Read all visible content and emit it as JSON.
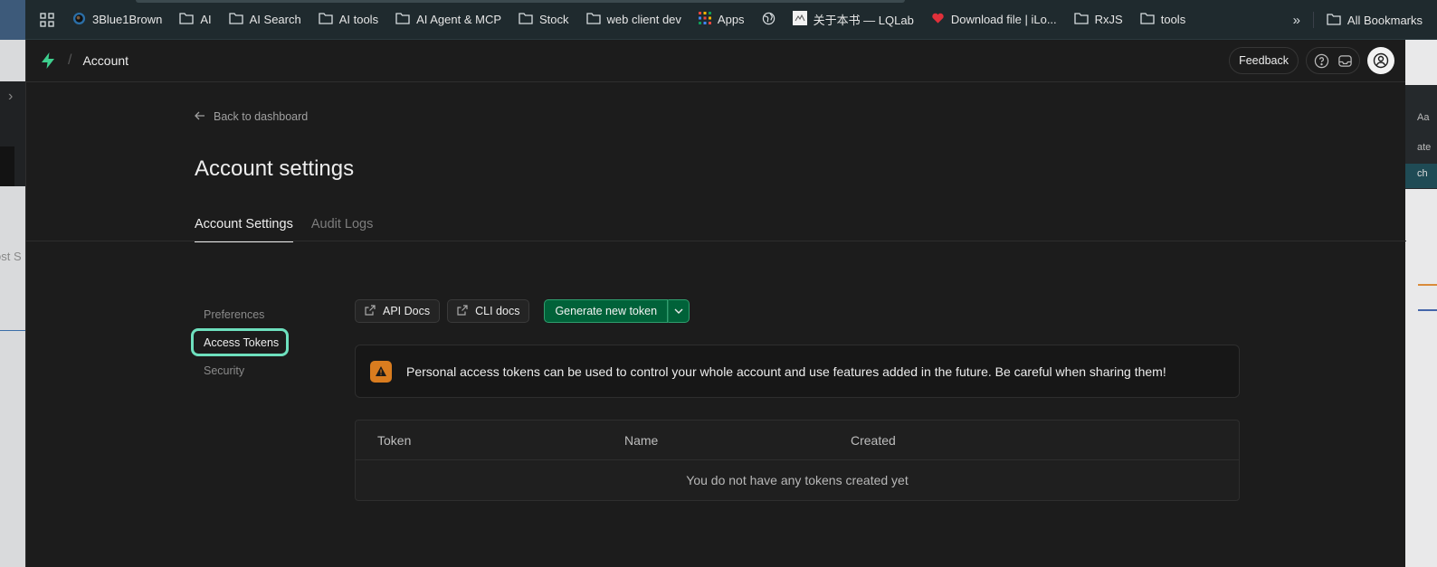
{
  "bookmarks": [
    {
      "label": "3Blue1Brown",
      "icon": "3blue1brown-icon"
    },
    {
      "label": "AI",
      "icon": "folder-icon"
    },
    {
      "label": "AI Search",
      "icon": "folder-icon"
    },
    {
      "label": "AI tools",
      "icon": "folder-icon"
    },
    {
      "label": "AI Agent & MCP",
      "icon": "folder-icon"
    },
    {
      "label": "Stock",
      "icon": "folder-icon"
    },
    {
      "label": "web client dev",
      "icon": "folder-icon"
    },
    {
      "label": "Apps",
      "icon": "apps-grid-icon"
    },
    {
      "label": "",
      "icon": "globe-icon"
    },
    {
      "label": "关于本书 — LQLab",
      "icon": "site-favicon-icon"
    },
    {
      "label": "Download file | iLo...",
      "icon": "heart-favicon-icon"
    },
    {
      "label": "RxJS",
      "icon": "folder-icon"
    },
    {
      "label": "tools",
      "icon": "folder-icon"
    }
  ],
  "bookmarks_all": "All Bookmarks",
  "desktop": {
    "left_text": "ost S",
    "right_texts": [
      "Aa",
      "ate",
      "ch"
    ]
  },
  "topbar": {
    "breadcrumb": "Account",
    "feedback_label": "Feedback"
  },
  "back_label": "Back to dashboard",
  "page_title": "Account settings",
  "tabs": [
    {
      "label": "Account Settings",
      "active": true
    },
    {
      "label": "Audit Logs",
      "active": false
    }
  ],
  "sidenav": [
    {
      "label": "Preferences",
      "active": false
    },
    {
      "label": "Access Tokens",
      "active": true
    },
    {
      "label": "Security",
      "active": false
    }
  ],
  "actions": {
    "api_docs": "API Docs",
    "cli_docs": "CLI docs",
    "generate": "Generate new token"
  },
  "alert_text": "Personal access tokens can be used to control your whole account and use features added in the future. Be careful when sharing them!",
  "table": {
    "columns": [
      "Token",
      "Name",
      "Created"
    ],
    "empty_text": "You do not have any tokens created yet"
  },
  "colors": {
    "accent_green": "#006239",
    "active_outline": "#6ee0be",
    "warning": "#d97c1f",
    "brand_logo": "#3ecf8e"
  }
}
